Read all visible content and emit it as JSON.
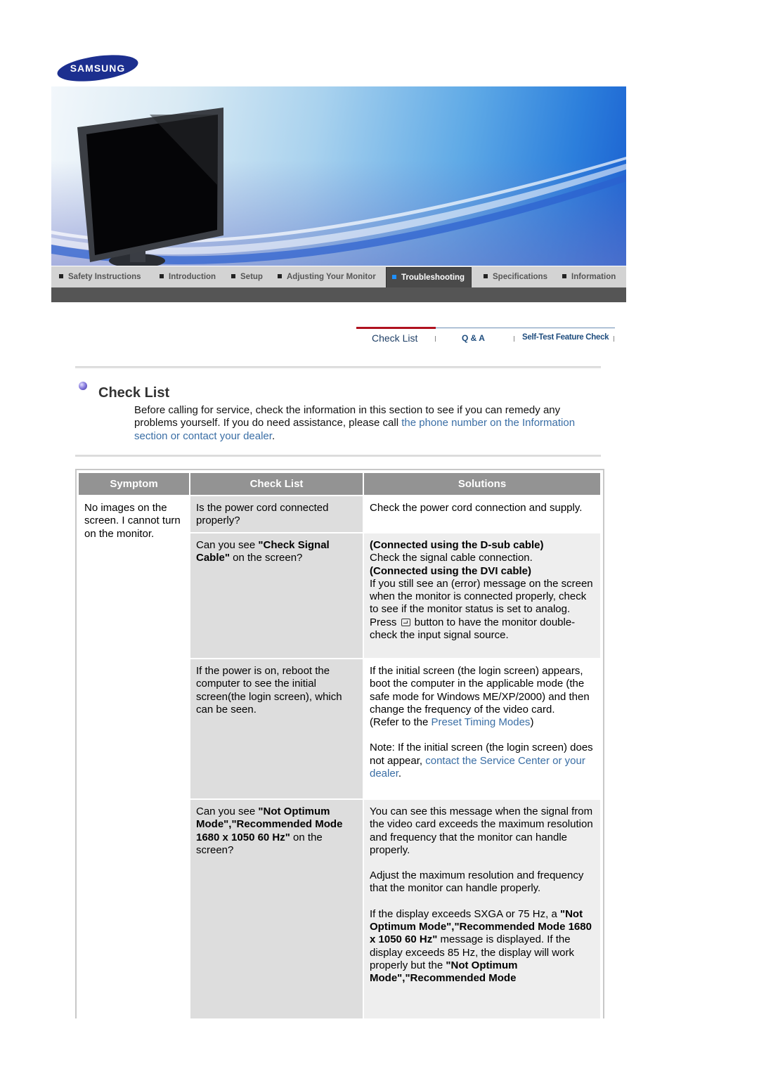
{
  "brand": {
    "logo_text": "SAMSUNG",
    "logo_color": "#1c2f8f"
  },
  "nav": {
    "items": [
      {
        "label": "Safety Instructions",
        "active": false
      },
      {
        "label": "Introduction",
        "active": false
      },
      {
        "label": "Setup",
        "active": false
      },
      {
        "label": "Adjusting Your Monitor",
        "active": false
      },
      {
        "label": "Troubleshooting",
        "active": true
      },
      {
        "label": "Specifications",
        "active": false
      },
      {
        "label": "Information",
        "active": false
      }
    ]
  },
  "subtabs": [
    {
      "label": "Check List",
      "active": true
    },
    {
      "label": "Q & A",
      "active": false
    },
    {
      "label": "Self-Test Feature Check",
      "active": false
    }
  ],
  "section": {
    "title": "Check List",
    "intro_text": "Before calling for service, check the information in this section to see if you can remedy any problems yourself. If you do need assistance, please call ",
    "intro_link": "the phone number on the Information section or contact your dealer",
    "intro_end": "."
  },
  "table": {
    "headers": {
      "symptom": "Symptom",
      "checklist": "Check List",
      "solutions": "Solutions"
    },
    "symptom": "No images on the screen. I cannot turn on the monitor.",
    "rows": [
      {
        "check": "Is the power cord connected properly?",
        "solution": "Check the power cord connection and supply."
      },
      {
        "check_pre": "Can you see ",
        "check_bold": "\"Check Signal Cable\"",
        "check_post": " on the screen?",
        "sol_h1": "(Connected using the D-sub cable)",
        "sol_t1": "Check the signal cable connection.",
        "sol_h2": "(Connected using the DVI cable)",
        "sol_t2": "If you still see an (error) message on the screen when the monitor is connected properly, check to see if the monitor status is set to analog.",
        "sol_t3_pre": "Press ",
        "sol_t3_icon": "source-button-icon",
        "sol_t3_post": " button to have the monitor double-check the input signal source."
      },
      {
        "check": "If the power is on, reboot the computer to see the initial screen(the login screen), which can be seen.",
        "sol_p1": "If the initial screen (the login screen) appears, boot the computer in the applicable mode (the safe mode for Windows ME/XP/2000) and then change the frequency of the video card.",
        "sol_p2_pre": "(Refer to the ",
        "sol_p2_link": "Preset Timing Modes",
        "sol_p2_post": ")",
        "sol_p3_pre": "Note: If the initial screen (the login screen) does not appear, ",
        "sol_p3_link": "contact the Service Center or your dealer",
        "sol_p3_post": "."
      },
      {
        "check_pre": "Can you see ",
        "check_bold": "\"Not Optimum Mode\",\"Recommended Mode 1680 x 1050 60 Hz\"",
        "check_post": " on the screen?",
        "sol_p1": "You can see this message when the signal from the video card exceeds the maximum resolution and frequency that the monitor can handle properly.",
        "sol_p2": "Adjust the maximum resolution and frequency that the monitor can handle properly.",
        "sol_p3_pre": "If the display exceeds SXGA or 75 Hz, a ",
        "sol_p3_bold": "\"Not Optimum Mode\",\"Recommended Mode 1680 x 1050 60 Hz\"",
        "sol_p3_mid": " message is displayed. If the display exceeds 85 Hz, the display will work properly but the ",
        "sol_p3_bold2": "\"Not Optimum Mode\",\"Recommended Mode"
      }
    ]
  }
}
